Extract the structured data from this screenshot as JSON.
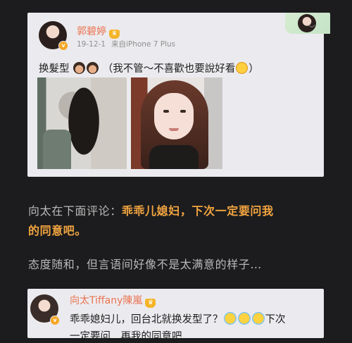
{
  "post": {
    "author": "郭碧婷",
    "date": "19-12-1",
    "source": "来自iPhone 7 Plus",
    "text_prefix": "换髮型",
    "text_suffix": "（我不管～不喜歡也要說好看",
    "text_close": "）"
  },
  "article": {
    "line1_plain": "向太在下面评论：",
    "line1_highlight": "乖乖儿媳妇，下次一定要问我",
    "line2_highlight": "的同意吧。",
    "line3": "态度随和，但言语间好像不是太满意的样子…"
  },
  "reply": {
    "author": "向太Tiffany陳嵐",
    "text": "乖乖媳妇儿，回台北就换发型了？",
    "text_tail": "下次",
    "text_line2": "一定要问…再我的同意吧"
  },
  "colors": {
    "page_bg": "#1c1c1e",
    "card_bg": "#ebebef",
    "author_name": "#eb7350",
    "highlight": "#f3a540",
    "body_text": "#b8b8b8"
  },
  "icons": [
    "crown-icon",
    "verified-badge-icon",
    "chevron-down-icon",
    "emoji-boy-icon",
    "emoji-yum-icon",
    "emoji-cry-icon"
  ]
}
